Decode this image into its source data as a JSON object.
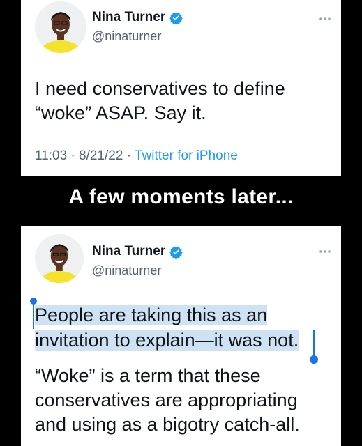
{
  "tweet1": {
    "display_name": "Nina Turner",
    "handle": "@ninaturner",
    "text": "I need conservatives to define “woke” ASAP. Say it.",
    "time": "11:03",
    "date": "8/21/22",
    "source": "Twitter for iPhone",
    "separator": " · "
  },
  "banner": {
    "text": "A few moments later..."
  },
  "tweet2": {
    "display_name": "Nina Turner",
    "handle": "@ninaturner",
    "selected_text": "People are taking this as an invitation to explain—it was not.",
    "text_paragraph2": "“Woke” is a term that these conservatives are appropriating and using as a bigotry catch-all."
  },
  "colors": {
    "verified": "#1d9bf0",
    "selection_highlight": "#cfe2f3",
    "selection_handle": "#1a73e8",
    "secondary_text": "#536471",
    "link": "#1d9bf0"
  },
  "icons": [
    "verified-badge-icon",
    "more-options-icon",
    "avatar-photo"
  ]
}
